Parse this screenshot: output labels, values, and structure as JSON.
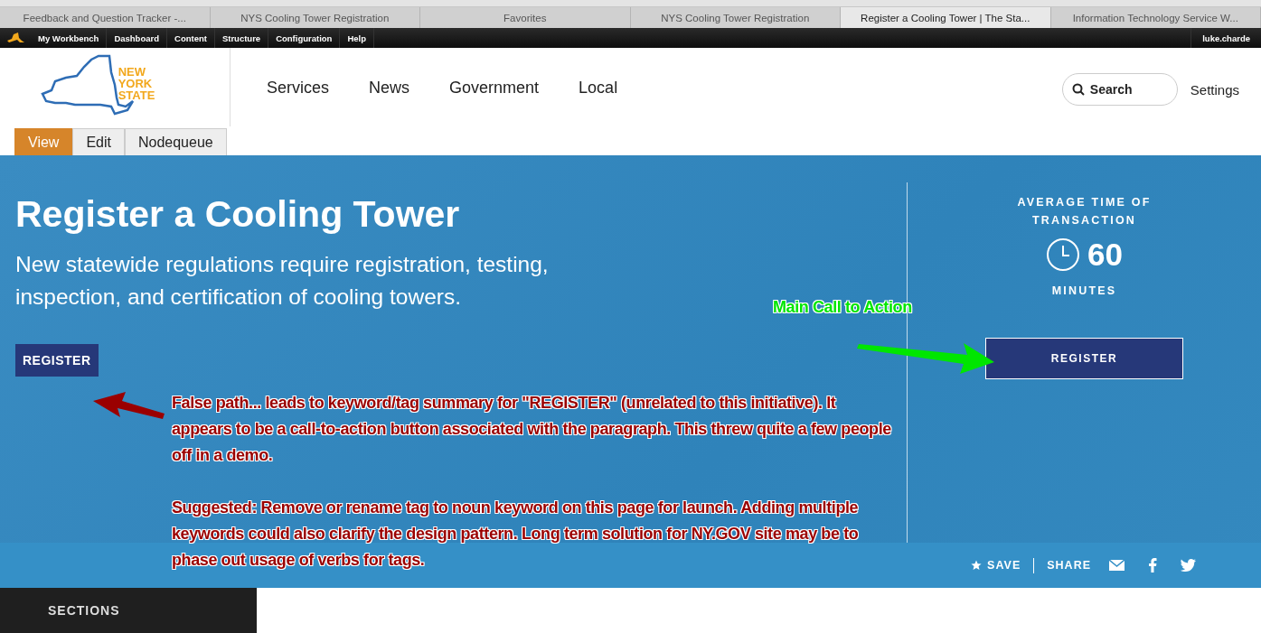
{
  "browser_tabs": [
    {
      "label": "Feedback and Question Tracker -...",
      "selected": false
    },
    {
      "label": "NYS Cooling Tower Registration",
      "selected": false
    },
    {
      "label": "Favorites",
      "selected": false
    },
    {
      "label": "NYS Cooling Tower Registration",
      "selected": false
    },
    {
      "label": "Register a Cooling Tower | The Sta...",
      "selected": true
    },
    {
      "label": "Information Technology Service W...",
      "selected": false
    }
  ],
  "admin_toolbar": {
    "items": [
      "My Workbench",
      "Dashboard",
      "Content",
      "Structure",
      "Configuration",
      "Help"
    ],
    "user": "luke.charde"
  },
  "header": {
    "logo_lines": [
      "NEW",
      "YORK",
      "STATE"
    ],
    "nav": [
      "Services",
      "News",
      "Government",
      "Local"
    ],
    "search": {
      "placeholder": "Search"
    },
    "settings": "Settings"
  },
  "local_tabs": [
    {
      "label": "View",
      "selected": true
    },
    {
      "label": "Edit",
      "selected": false
    },
    {
      "label": "Nodequeue",
      "selected": false
    }
  ],
  "hero": {
    "title": "Register a Cooling Tower",
    "subtitle": "New statewide regulations require registration, testing, inspection, and certification of cooling towers.",
    "tag": "REGISTER",
    "time": {
      "label_lines": [
        "AVERAGE TIME OF",
        "TRANSACTION"
      ],
      "value": "60",
      "unit": "MINUTES"
    },
    "cta": "REGISTER"
  },
  "share_bar": {
    "save": "SAVE",
    "share": "SHARE"
  },
  "sections": {
    "heading": "SECTIONS"
  },
  "annotations": [
    {
      "kind": "label",
      "color": "#00e600",
      "paragraphs": [
        "Main Call to Action"
      ]
    },
    {
      "kind": "note",
      "color": "#9a0000",
      "paragraphs": [
        "False path... leads to keyword/tag summary for \"REGISTER\" (unrelated to this initiative).  It appears to be a call-to-action button associated with the paragraph. This threw quite a few people off in a demo.",
        "Suggested: Remove or rename tag to noun keyword on this page for launch. Adding multiple keywords could also clarify the design pattern.  Long term solution for NY.GOV site may be to phase out usage of verbs for tags."
      ]
    }
  ]
}
